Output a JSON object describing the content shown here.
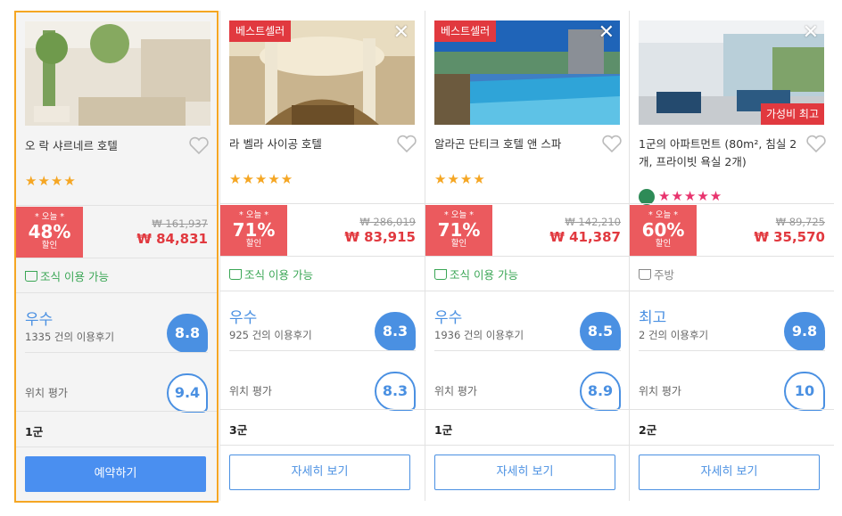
{
  "cards": [
    {
      "badge": "",
      "name": "오 락 샤르네르 호텔",
      "stars": "★★★★",
      "today": "* 오늘 *",
      "discount": "48%",
      "discount_label": "할인",
      "original_price": "₩ 161,937",
      "price": "₩ 84,831",
      "amenity": "조식 이용 가능",
      "rating_word": "우수",
      "reviews": "1335 건의 이용후기",
      "score": "8.8",
      "location_label": "위치 평가",
      "location_score": "9.4",
      "district": "1군",
      "button": "예약하기"
    },
    {
      "badge": "베스트셀러",
      "name": "라 벨라 사이공 호텔",
      "stars": "★★★★★",
      "today": "* 오늘 *",
      "discount": "71%",
      "discount_label": "할인",
      "original_price": "₩ 286,019",
      "price": "₩ 83,915",
      "amenity": "조식 이용 가능",
      "rating_word": "우수",
      "reviews": "925 건의 이용후기",
      "score": "8.3",
      "location_label": "위치 평가",
      "location_score": "8.3",
      "district": "3군",
      "button": "자세히 보기"
    },
    {
      "badge": "베스트셀러",
      "name": "알라곤 단티크 호텔 앤 스파",
      "stars": "★★★★",
      "today": "* 오늘 *",
      "discount": "71%",
      "discount_label": "할인",
      "original_price": "₩ 142,210",
      "price": "₩ 41,387",
      "amenity": "조식 이용 가능",
      "rating_word": "우수",
      "reviews": "1936 건의 이용후기",
      "score": "8.5",
      "location_label": "위치 평가",
      "location_score": "8.9",
      "district": "1군",
      "button": "자세히 보기"
    },
    {
      "badge": "가성비 최고",
      "name": "1군의 아파트먼트 (80m², 침실 2개, 프라이빗 욕실 2개)",
      "stars": "★★★★★",
      "today": "* 오늘 *",
      "discount": "60%",
      "discount_label": "할인",
      "original_price": "₩ 89,725",
      "price": "₩ 35,570",
      "amenity": "주방",
      "rating_word": "최고",
      "reviews": "2 건의 이용후기",
      "score": "9.8",
      "location_label": "위치 평가",
      "location_score": "10",
      "district": "2군",
      "button": "자세히 보기"
    }
  ],
  "colors": {
    "accent_blue": "#4a90e2",
    "discount_red": "#eb5a5e",
    "price_red": "#e1393f",
    "selected_border": "#f5a623",
    "amenity_green": "#3aa655"
  }
}
